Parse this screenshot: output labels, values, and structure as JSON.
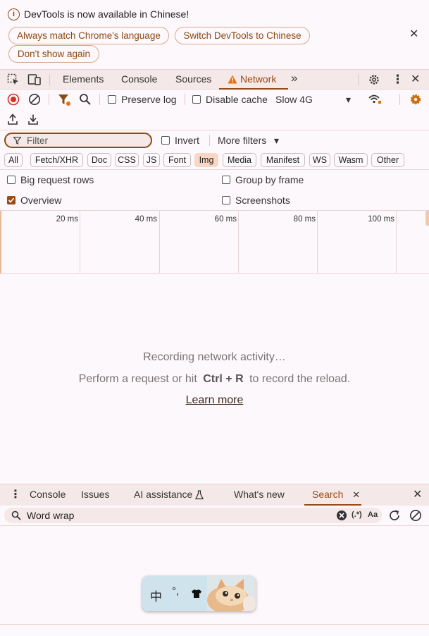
{
  "infobar": {
    "message": "DevTools is now available in Chinese!",
    "buttons": [
      "Always match Chrome's language",
      "Switch DevTools to Chinese",
      "Don't show again"
    ],
    "info_icon": "i",
    "close_icon": "✕"
  },
  "main_tabs": {
    "items": [
      "Elements",
      "Console",
      "Sources",
      "Network"
    ],
    "active": "Network",
    "more_icon": "»",
    "menu_icon": "⋮",
    "close_icon": "✕"
  },
  "network_toolbar": {
    "preserve_log": "Preserve log",
    "disable_cache": "Disable cache",
    "throttling": "Slow 4G",
    "dropdown_icon": "▾"
  },
  "filter": {
    "placeholder": "Filter",
    "invert": "Invert",
    "more_filters": "More filters",
    "chips": [
      "All",
      "Fetch/XHR",
      "Doc",
      "CSS",
      "JS",
      "Font",
      "Img",
      "Media",
      "Manifest",
      "WS",
      "Wasm",
      "Other"
    ],
    "selected_chip": "Img"
  },
  "settings": {
    "big_request_rows": "Big request rows",
    "group_by_frame": "Group by frame",
    "overview": "Overview",
    "screenshots": "Screenshots",
    "overview_checked": true
  },
  "overview_ticks": [
    "20 ms",
    "40 ms",
    "60 ms",
    "80 ms",
    "100 ms"
  ],
  "empty_state": {
    "line1": "Recording network activity…",
    "line2_prefix": "Perform a request or hit",
    "shortcut_ctrl": "Ctrl",
    "shortcut_plus": "+",
    "shortcut_r": "R",
    "line2_suffix": "to record the reload.",
    "learn_more": "Learn more"
  },
  "drawer": {
    "menu_icon": "⋮",
    "tabs": [
      "Console",
      "Issues",
      "AI assistance",
      "What's new",
      "Search"
    ],
    "active": "Search",
    "tab_close_icon": "✕",
    "close_icon": "✕",
    "search_value": "Word wrap",
    "regex_label": "(.*)",
    "case_label": "Aa"
  },
  "ime": {
    "char": "中",
    "punct": "°,"
  },
  "colors": {
    "accent": "#9a4a12",
    "toolbar_bg": "#f5e8e9",
    "panel_bg": "#fdf8fb",
    "warning": "#e8710a",
    "record_red": "#d93025"
  }
}
